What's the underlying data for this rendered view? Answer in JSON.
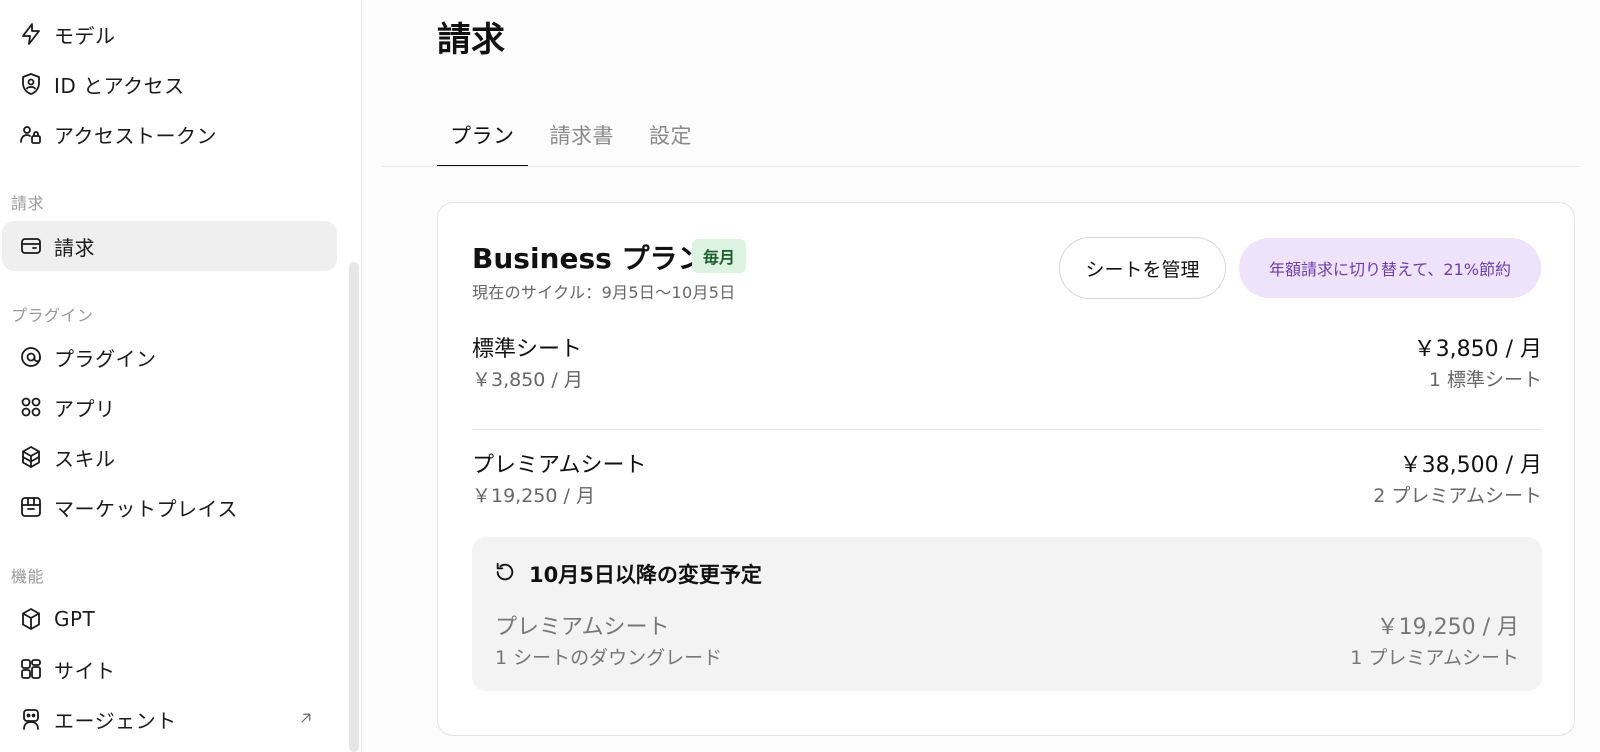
{
  "sidebar": {
    "top_items": [
      {
        "label": "モデル",
        "icon": "bolt-icon"
      },
      {
        "label": "ID とアクセス",
        "icon": "shield-user-icon"
      },
      {
        "label": "アクセストークン",
        "icon": "lock-user-icon"
      }
    ],
    "billing_section": {
      "label": "請求",
      "items": [
        {
          "label": "請求",
          "icon": "card-icon",
          "active": true
        }
      ]
    },
    "plugins_section": {
      "label": "プラグイン",
      "items": [
        {
          "label": "プラグイン",
          "icon": "at-icon"
        },
        {
          "label": "アプリ",
          "icon": "apps-icon"
        },
        {
          "label": "スキル",
          "icon": "cube-stack-icon"
        },
        {
          "label": "マーケットプレイス",
          "icon": "store-icon"
        }
      ]
    },
    "features_section": {
      "label": "機能",
      "items": [
        {
          "label": "GPT",
          "icon": "cube-icon"
        },
        {
          "label": "サイト",
          "icon": "layout-icon"
        },
        {
          "label": "エージェント",
          "icon": "robot-icon",
          "external": true
        }
      ]
    }
  },
  "main": {
    "title": "請求",
    "tabs": [
      {
        "label": "プラン",
        "active": true
      },
      {
        "label": "請求書"
      },
      {
        "label": "設定"
      }
    ],
    "plan": {
      "name": "Business プラン",
      "badge": "毎月",
      "cycle": "現在のサイクル：9月5日〜10月5日",
      "manage_button": "シートを管理",
      "annual_button": "年額請求に切り替えて、21%節約",
      "seats": [
        {
          "name": "標準シート",
          "unit_price": "￥3,850 / 月",
          "total": "￥3,850 / 月",
          "count": "1 標準シート"
        },
        {
          "name": "プレミアムシート",
          "unit_price": "￥19,250 / 月",
          "total": "￥38,500 / 月",
          "count": "2 プレミアムシート"
        }
      ],
      "pending": {
        "title": "10月5日以降の変更予定",
        "name": "プレミアムシート",
        "desc": "1 シートのダウングレード",
        "total": "￥19,250 / 月",
        "count": "1 プレミアムシート"
      }
    }
  },
  "colors": {
    "badge_bg": "#dcf3e1",
    "badge_text": "#1e5e2d",
    "annual_bg": "#efe2fb",
    "annual_text": "#6b3fa8",
    "active_nav_bg": "#efefef"
  }
}
